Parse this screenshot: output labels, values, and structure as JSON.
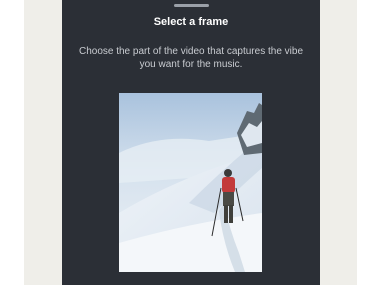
{
  "sheet": {
    "title": "Select a frame",
    "subtitle": "Choose the part of the video that captures the vibe you want for the music."
  },
  "frame": {
    "image_description_icon": "mountain-hiker-image"
  },
  "colors": {
    "sheet_bg": "#2b2f36",
    "page_bg": "#efeee9",
    "title_text": "#ffffff",
    "subtitle_text": "#c9ccd1"
  }
}
